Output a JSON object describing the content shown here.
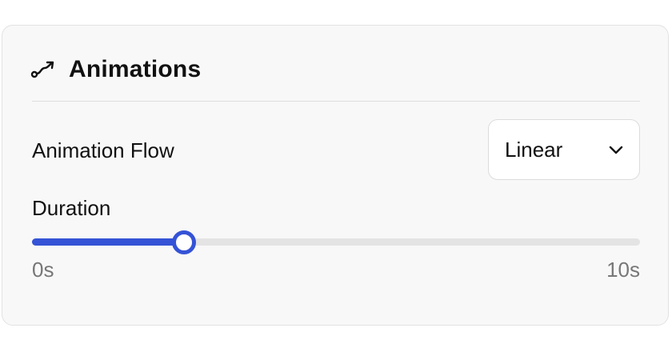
{
  "panel": {
    "icon": "curve-arrow-icon",
    "title": "Animations"
  },
  "animation_flow": {
    "label": "Animation Flow",
    "selected": "Linear",
    "chevron_icon": "chevron-down-icon"
  },
  "duration": {
    "label": "Duration",
    "min_label": "0s",
    "max_label": "10s",
    "value_fraction": 0.25
  },
  "colors": {
    "accent": "#3553d6",
    "track": "#e4e4e4",
    "panel_bg": "#f8f8f8"
  }
}
